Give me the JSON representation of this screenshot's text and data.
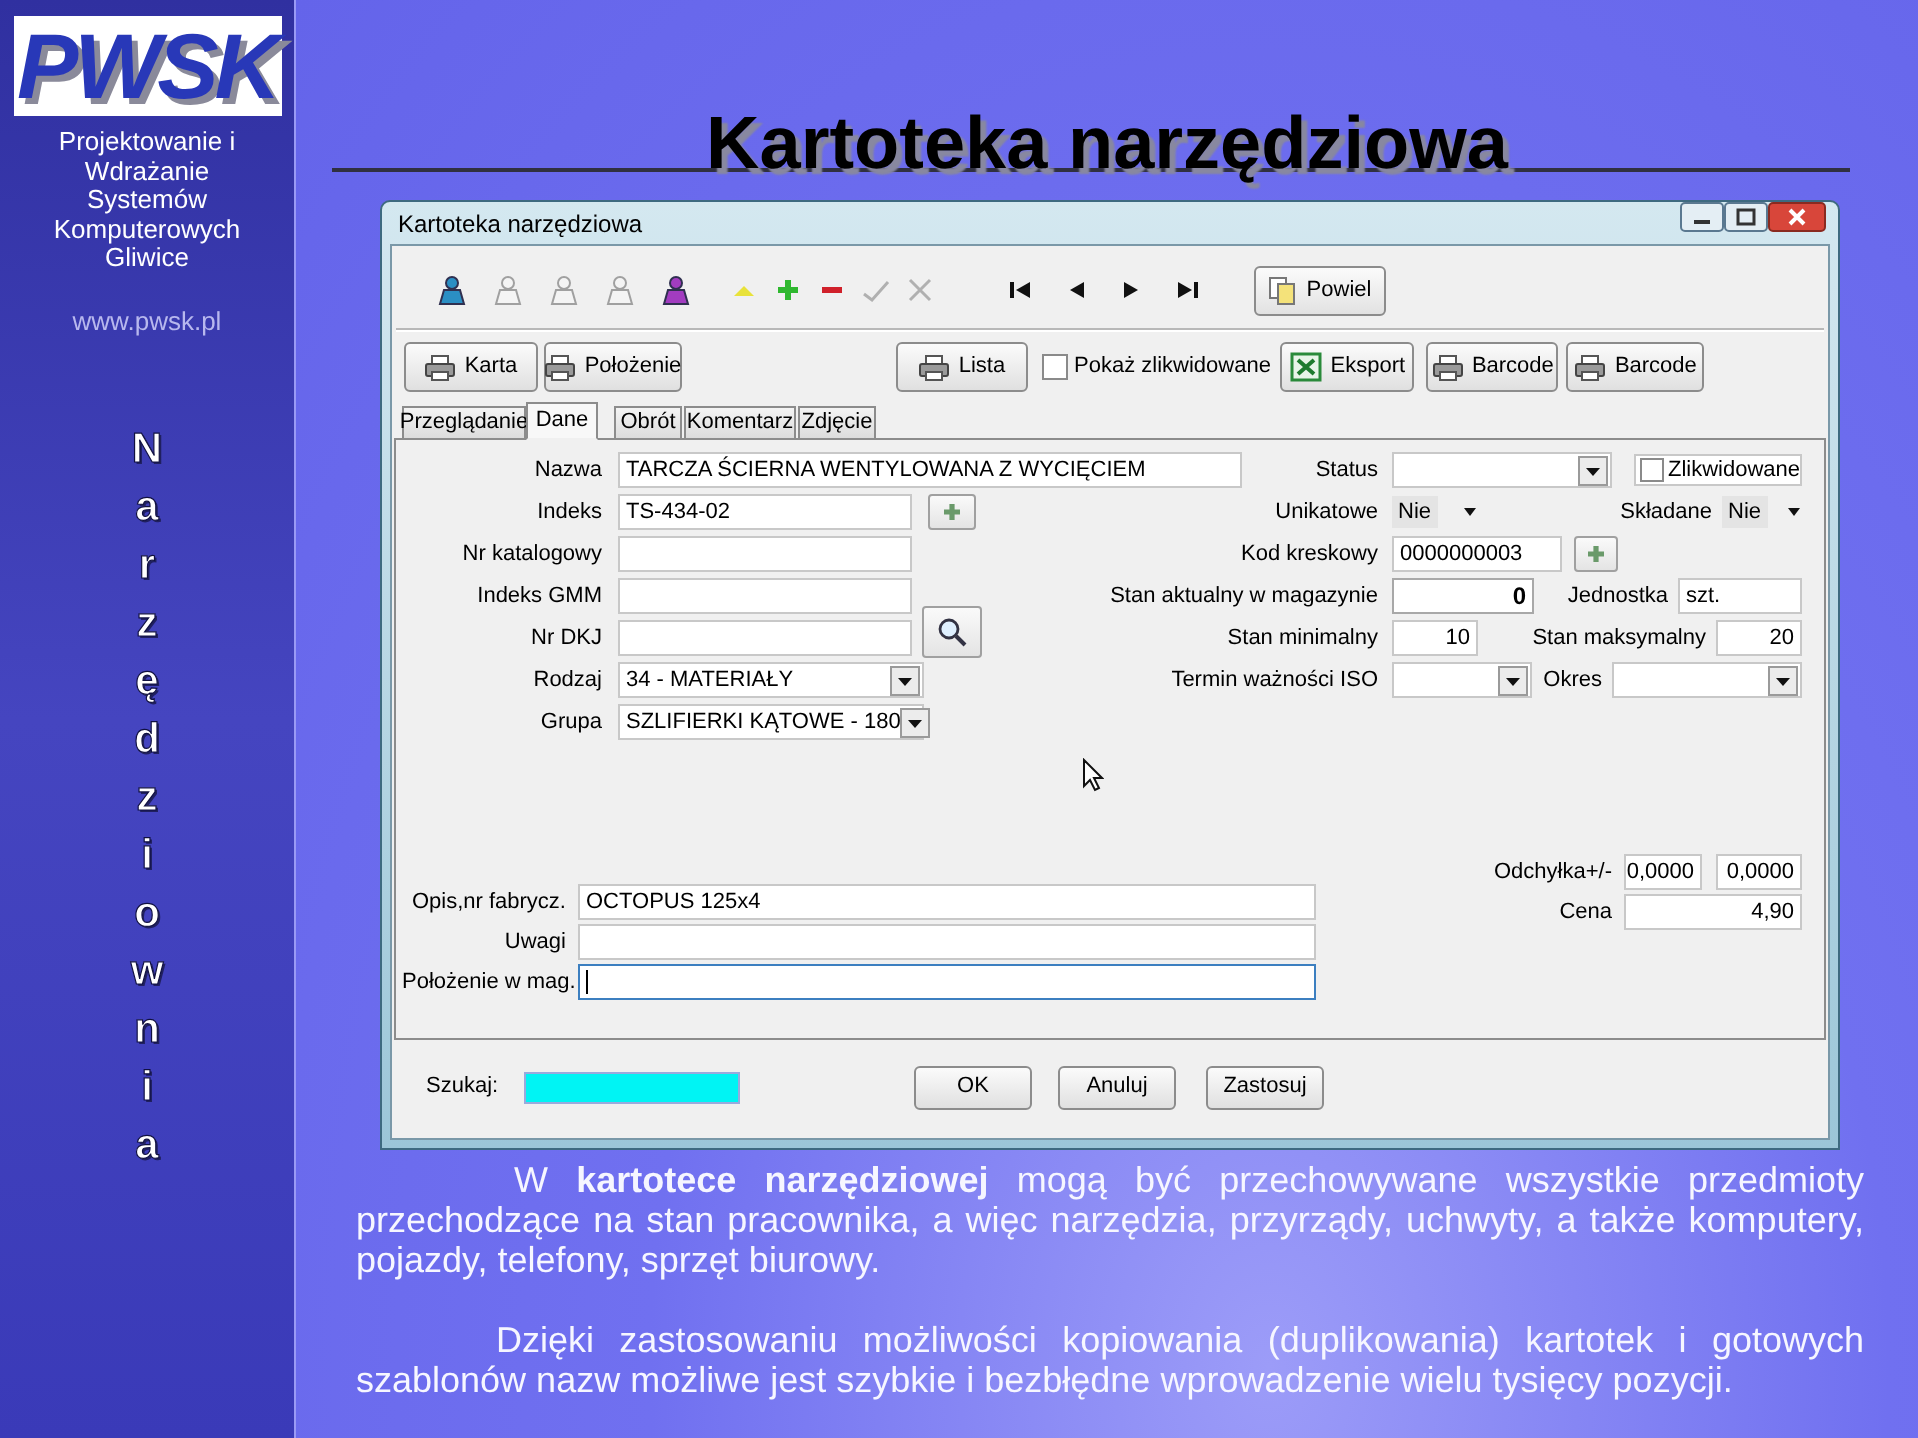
{
  "sidebar": {
    "logo": "PWSK",
    "company_lines": [
      "Projektowanie i",
      "Wdrażanie",
      "Systemów",
      "Komputerowych",
      "Gliwice"
    ],
    "website": "www.pwsk.pl",
    "vertical_title": "Narzędziownia"
  },
  "slide_title": "Kartoteka narzędziowa",
  "window": {
    "title": "Kartoteka narzędziowa",
    "toolbar": [
      {
        "kind": "card",
        "disabled": false,
        "color": "#2b8fc4"
      },
      {
        "kind": "card",
        "disabled": true
      },
      {
        "kind": "card",
        "disabled": true
      },
      {
        "kind": "card",
        "disabled": true
      },
      {
        "kind": "card",
        "disabled": false,
        "color": "#a23cc0"
      },
      {
        "kind": "up",
        "disabled": false,
        "color": "#e8e23a"
      },
      {
        "kind": "plus",
        "disabled": false,
        "color": "#2fb82f"
      },
      {
        "kind": "minus",
        "disabled": false,
        "color": "#d0202a"
      },
      {
        "kind": "check",
        "disabled": true
      },
      {
        "kind": "cross",
        "disabled": true
      }
    ],
    "navigation": [
      {
        "kind": "first"
      },
      {
        "kind": "previous"
      },
      {
        "kind": "next"
      },
      {
        "kind": "last"
      }
    ],
    "copy_button": "Powiel",
    "actions": [
      {
        "kind": "print",
        "label": "Karta"
      },
      {
        "kind": "print",
        "label": "Położenie"
      },
      {
        "kind": "print",
        "label": "Lista"
      },
      {
        "kind": "checkbox",
        "label": "Pokaż zlikwidowane",
        "checked": false
      },
      {
        "kind": "excel",
        "label": "Eksport"
      },
      {
        "kind": "print",
        "label": "Barcode"
      },
      {
        "kind": "print",
        "label": "Barcode"
      }
    ],
    "tabs": [
      {
        "label": "Przeglądanie",
        "selected": false
      },
      {
        "label": "Dane",
        "selected": true
      },
      {
        "label": "Obrót",
        "selected": false
      },
      {
        "label": "Komentarz",
        "selected": false
      },
      {
        "label": "Zdjęcie",
        "selected": false
      }
    ],
    "rows": [
      {
        "left": {
          "kind": "text",
          "label": "Nazwa",
          "value": "TARCZA ŚCIERNA WENTYLOWANA Z WYCIĘCIEM"
        },
        "right": [
          {
            "kind": "combo",
            "label": "Status"
          },
          {
            "kind": "checkbox",
            "label": "Zlikwidowane",
            "checked": false
          }
        ]
      },
      {
        "left": {
          "kind": "text",
          "label": "Indeks",
          "value": "TS-434-02",
          "button": {
            "kind": "add"
          }
        },
        "right": [
          {
            "kind": "select",
            "label": "Unikatowe",
            "value": "Nie"
          },
          {
            "kind": "select",
            "label": "Składane",
            "value": "Nie"
          }
        ]
      },
      {
        "left": {
          "kind": "text",
          "label": "Nr katalogowy"
        },
        "right": [
          {
            "kind": "text",
            "label": "Kod kreskowy",
            "value": "0000000003",
            "button": {
              "kind": "add"
            }
          }
        ]
      },
      {
        "left": {
          "kind": "text",
          "label": "Indeks GMM"
        },
        "right": [
          {
            "kind": "readonly",
            "label": "Stan aktualny w magazynie",
            "value": "0"
          },
          {
            "kind": "text",
            "label": "Jednostka",
            "value": "szt."
          }
        ]
      },
      {
        "left": {
          "kind": "text",
          "label": "Nr DKJ",
          "button": {
            "kind": "search"
          }
        },
        "right": [
          {
            "kind": "number",
            "label": "Stan minimalny",
            "value": "10"
          },
          {
            "kind": "number",
            "label": "Stan maksymalny",
            "value": "20"
          }
        ]
      },
      {
        "left": {
          "kind": "combo",
          "label": "Rodzaj",
          "value": "34 - MATERIAŁY"
        },
        "right": [
          {
            "kind": "combo",
            "label": "Termin ważności ISO"
          },
          {
            "kind": "combo",
            "label": "Okres"
          }
        ]
      },
      {
        "left": {
          "kind": "combo",
          "label": "Grupa",
          "value": "SZLIFIERKI KĄTOWE - 180"
        }
      }
    ],
    "deviation": {
      "label": "Odchyłka+/-",
      "values": [
        "0,0000",
        "0,0000"
      ]
    },
    "price": {
      "label": "Cena",
      "value": "4,90"
    },
    "notes": [
      {
        "label": "Opis,nr fabrycz.",
        "value": "OCTOPUS 125x4",
        "focused": false
      },
      {
        "label": "Uwagi",
        "focused": false
      },
      {
        "label": "Położenie w mag.",
        "focused": true
      }
    ],
    "search": {
      "label": "Szukaj:"
    },
    "buttons": [
      "OK",
      "Anuluj",
      "Zastosuj"
    ]
  },
  "paragraphs": [
    "W **kartotece narzędziowej** mogą być przechowywane wszystkie przedmioty przechodzące na stan pracownika, a więc narzędzia, przyrządy, uchwyty, a także komputery, pojazdy, telefony, sprzęt biurowy.",
    "Dzięki zastosowaniu możliwości kopiowania (duplikowania) kartotek i gotowych szablonów nazw możliwe jest szybkie i bezbłędne wprowadzenie wielu tysięcy pozycji."
  ]
}
